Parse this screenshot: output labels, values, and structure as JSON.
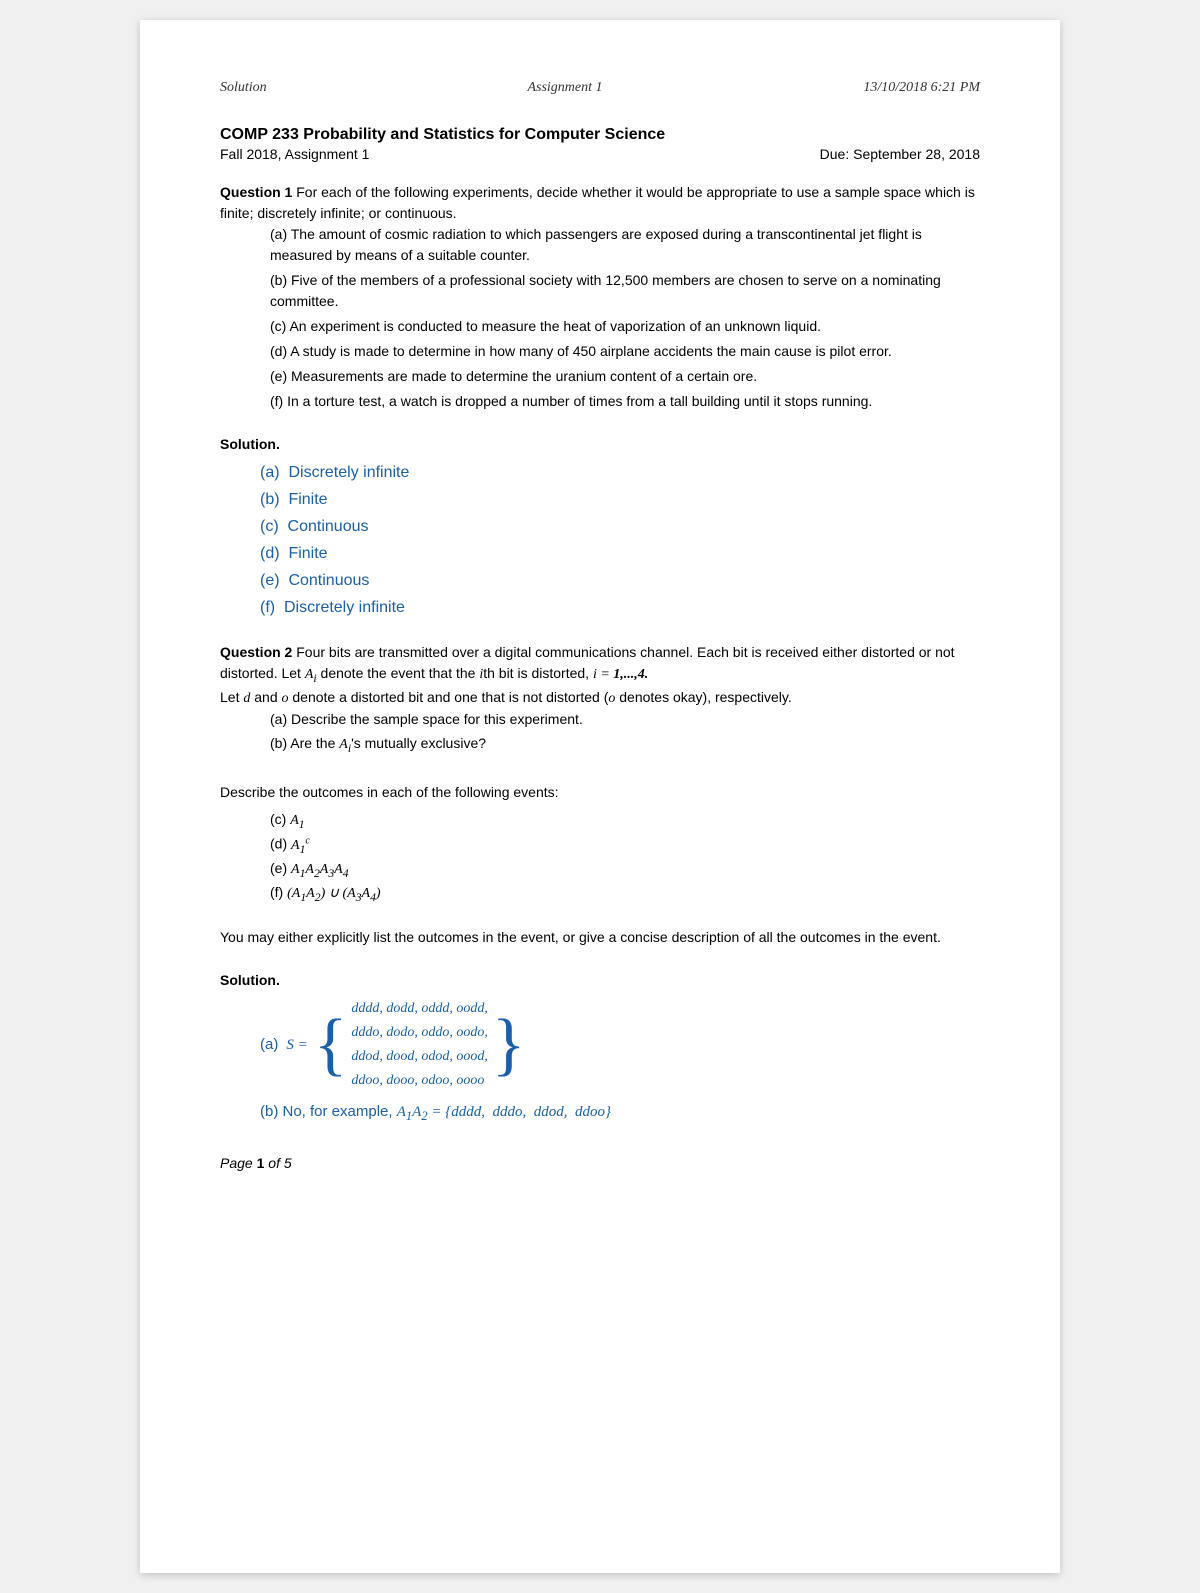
{
  "header": {
    "left": "Solution",
    "center": "Assignment 1",
    "right": "13/10/2018 6:21 PM"
  },
  "course": {
    "title": "COMP 233 Probability and Statistics for Computer Science",
    "subtitle_left": "Fall 2018, Assignment 1",
    "subtitle_right": "Due: September 28, 2018"
  },
  "q1": {
    "label": "Question 1",
    "intro": "For each of the following experiments, decide whether it would be appropriate to use a sample space which is finite; discretely infinite; or continuous.",
    "parts": [
      "(a) The amount of cosmic radiation to which passengers are exposed during a transcontinental jet flight is measured by means of a suitable counter.",
      "(b) Five of the members of a professional society with 12,500 members are chosen to serve on a nominating committee.",
      "(c) An experiment is conducted to measure the heat of vaporization of an unknown liquid.",
      "(d) A study is made to determine in how many of 450 airplane accidents the main cause is pilot error.",
      "(e) Measurements are made to determine the uranium content of a certain ore.",
      "(f) In a torture test, a watch is dropped a number of times from a tall building until it stops running."
    ],
    "solution_label": "Solution.",
    "solutions": [
      {
        "label": "(a)",
        "answer": "Discretely infinite"
      },
      {
        "label": "(b)",
        "answer": "Finite"
      },
      {
        "label": "(c)",
        "answer": "Continuous"
      },
      {
        "label": "(d)",
        "answer": "Finite"
      },
      {
        "label": "(e)",
        "answer": "Continuous"
      },
      {
        "label": "(f)",
        "answer": "Discretely infinite"
      }
    ]
  },
  "q2": {
    "label": "Question 2",
    "intro": "Four bits are transmitted over a digital communications channel. Each bit is received either distorted or not distorted. Let",
    "intro2": "denote the event that the ith bit is distorted,",
    "intro3": "Let d and o denote a distorted bit and one that is not distorted (o denotes okay), respectively.",
    "parts_ab": [
      "(a) Describe the sample space for this experiment.",
      "(b) Are the A_i's mutually exclusive?"
    ],
    "describe_text": "Describe the outcomes in each of the following events:",
    "parts_cf": [
      "(c) A_1",
      "(d) A_1^c",
      "(e) A_1 A_2 A_3 A_4",
      "(f) (A_1 A_2) ∪ (A_3 A_4)"
    ],
    "may_text": "You may either explicitly list the outcomes in the event, or give a concise description of all the outcomes in the event.",
    "solution_label": "Solution.",
    "sol_a_label": "(a)",
    "sol_a_eq": "S =",
    "sol_a_matrix": [
      "dddd,  dodd,  oddd,  oodd,",
      "dddo,  dodo,  oddo,  oodo,",
      "ddod,  dood,  odod,  oood,",
      "ddoo,  dooo,  odoo,  oooo"
    ],
    "sol_b_label": "(b)",
    "sol_b_text": "No, for example,",
    "sol_b_math": "A_1 A_2 = {dddd,  dddo,  ddod,  ddoo}"
  },
  "footer": {
    "text": "Page",
    "bold": "1",
    "text2": "of",
    "total": "5"
  },
  "colors": {
    "accent": "#1a5fa8",
    "text": "#222222"
  }
}
